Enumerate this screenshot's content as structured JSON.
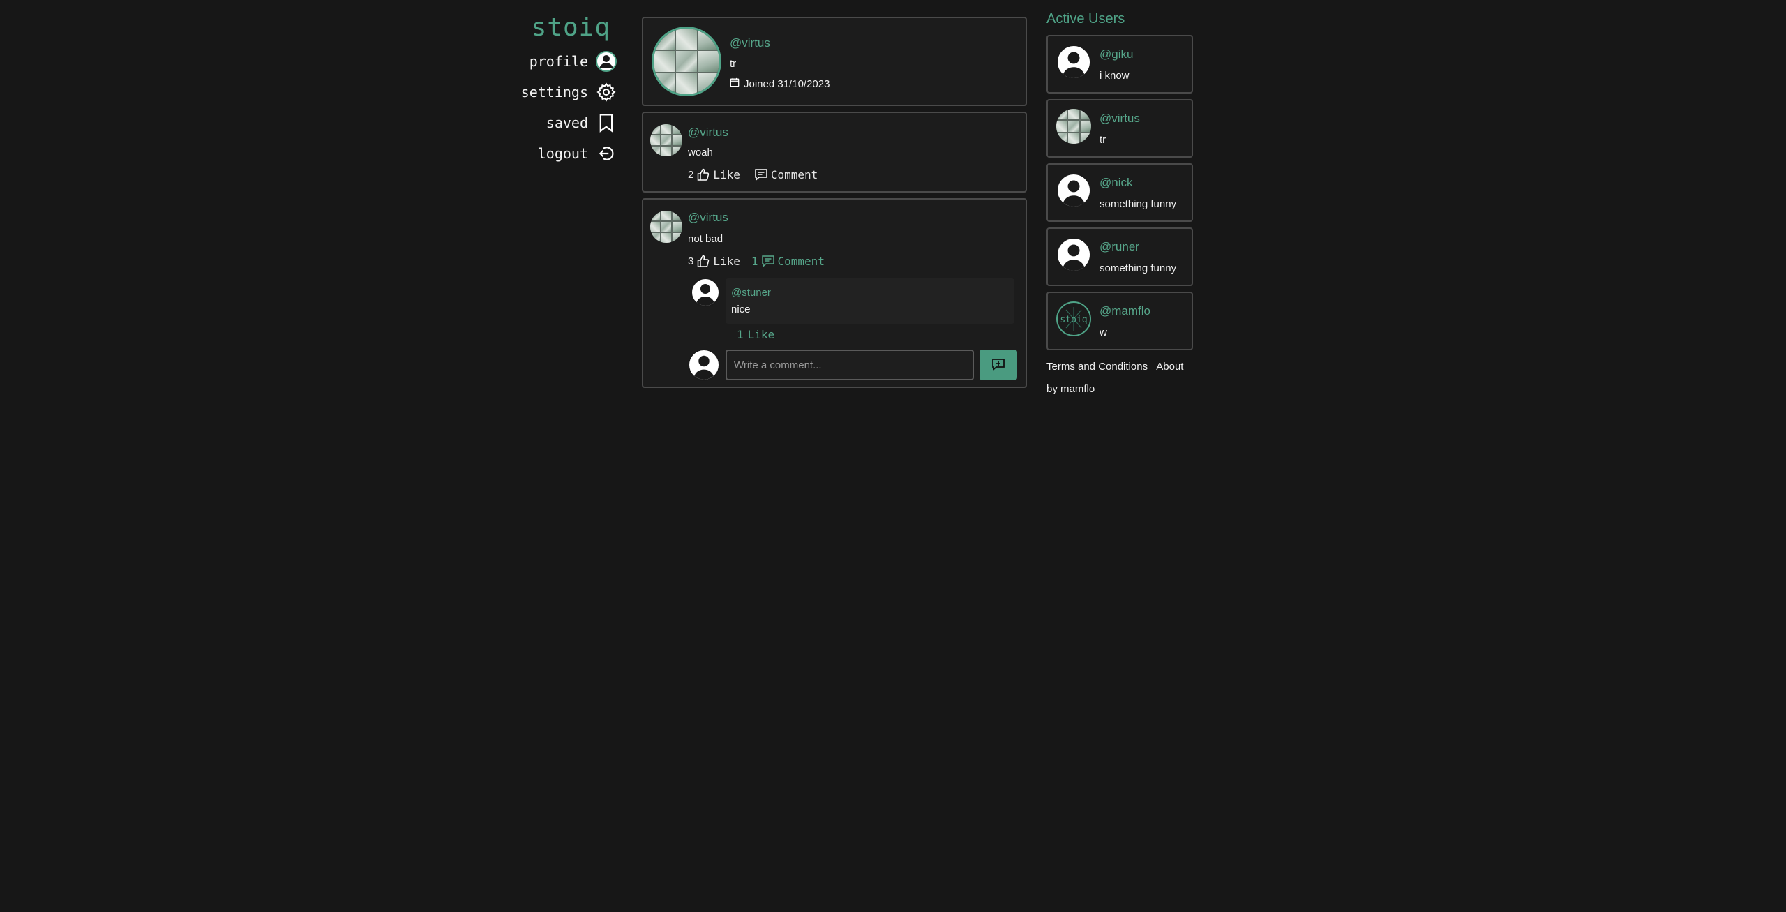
{
  "brand": "stoiq",
  "nav": {
    "profile": "profile",
    "settings": "settings",
    "saved": "saved",
    "logout": "logout"
  },
  "profile": {
    "handle": "@virtus",
    "bio": "tr",
    "joined": "Joined 31/10/2023"
  },
  "posts": [
    {
      "handle": "@virtus",
      "text": "woah",
      "likes": "2",
      "like_label": "Like",
      "comments": "",
      "comment_label": "Comment"
    },
    {
      "handle": "@virtus",
      "text": "not bad",
      "likes": "3",
      "like_label": "Like",
      "comments": "1",
      "comment_label": "Comment",
      "replies": [
        {
          "handle": "@stuner",
          "text": "nice",
          "likes": "1",
          "like_label": "Like"
        }
      ],
      "comment_placeholder": "Write a comment..."
    }
  ],
  "sidebar": {
    "title": "Active Users",
    "users": [
      {
        "handle": "@giku",
        "bio": "i know",
        "avatar": "default"
      },
      {
        "handle": "@virtus",
        "bio": "tr",
        "avatar": "collage"
      },
      {
        "handle": "@nick",
        "bio": "something funny",
        "avatar": "default"
      },
      {
        "handle": "@runer",
        "bio": "something funny",
        "avatar": "default"
      },
      {
        "handle": "@mamflo",
        "bio": "w",
        "avatar": "logo"
      }
    ],
    "avatar_logo_text": "stoiq",
    "footer": {
      "terms": "Terms and Conditions",
      "about": "About",
      "credit": "by mamflo"
    }
  },
  "colors": {
    "accent": "#4fa387",
    "background": "#171717",
    "card_border": "#4a4a4a"
  }
}
